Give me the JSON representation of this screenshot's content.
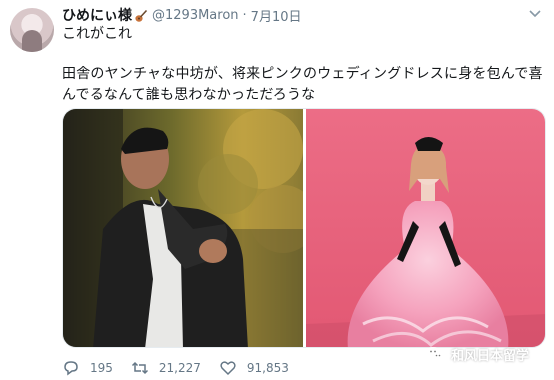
{
  "author": {
    "name": "ひめにぃ様",
    "handle": "@1293Maron",
    "separator": "·",
    "date": "7月10日"
  },
  "tweet": {
    "line1": "これがこれ",
    "body": "田舎のヤンチャな中坊が、将来ピンクのウェディングドレスに身を包んで喜んでるなんて誰も思わなかっただろうな"
  },
  "media": {
    "left_image": "young man in dark jacket outdoors",
    "right_image": "person in pink wedding dress against pink backdrop"
  },
  "actions": {
    "reply_count": "195",
    "retweet_count": "21,227",
    "like_count": "91,853"
  },
  "watermark": {
    "text": "和风日本留学",
    "icon": "wechat-icon"
  },
  "icons": {
    "caret": "chevron-down-icon",
    "reply": "reply-icon",
    "retweet": "retweet-icon",
    "like": "heart-icon",
    "badge": "guitar-emoji"
  },
  "colors": {
    "muted": "#657786",
    "text": "#14171a",
    "pink_backdrop": "#e9607a",
    "dress": "#f5a2bd"
  }
}
